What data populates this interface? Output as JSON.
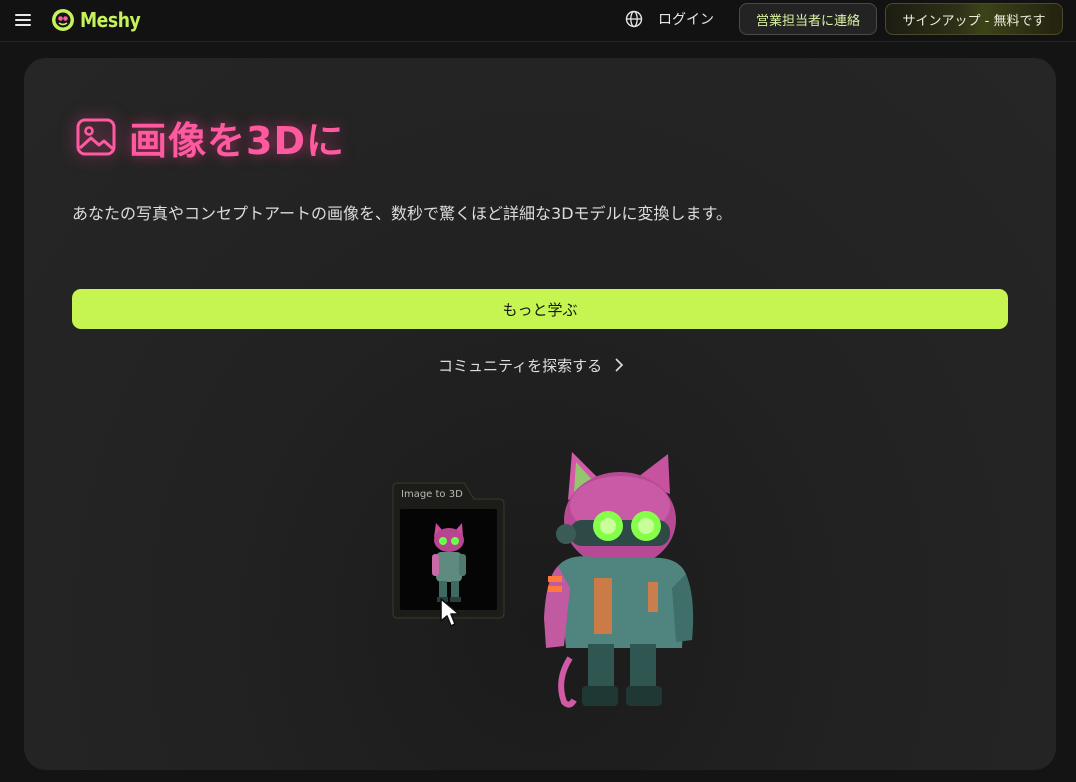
{
  "header": {
    "logo_text": "Meshy",
    "login_label": "ログイン",
    "contact_sales_label": "営業担当者に連絡",
    "signup_label": "サインアップ - 無料です"
  },
  "hero": {
    "title": "画像を3Dに",
    "subtitle": "あなたの写真やコンセプトアートの画像を、数秒で驚くほど詳細な3Dモデルに変換します。",
    "learn_more_label": "もっと学ぶ",
    "explore_label": "コミュニティを探索する"
  },
  "demo": {
    "mini_card_label": "Image to 3D"
  },
  "colors": {
    "accent_lime": "#c6f552",
    "accent_pink": "#ff5aa0",
    "background": "#141414"
  },
  "icons": [
    "hamburger-menu-icon",
    "meshy-logo-icon",
    "globe-icon",
    "image-icon",
    "chevron-right-icon",
    "pointer-cursor-icon"
  ]
}
